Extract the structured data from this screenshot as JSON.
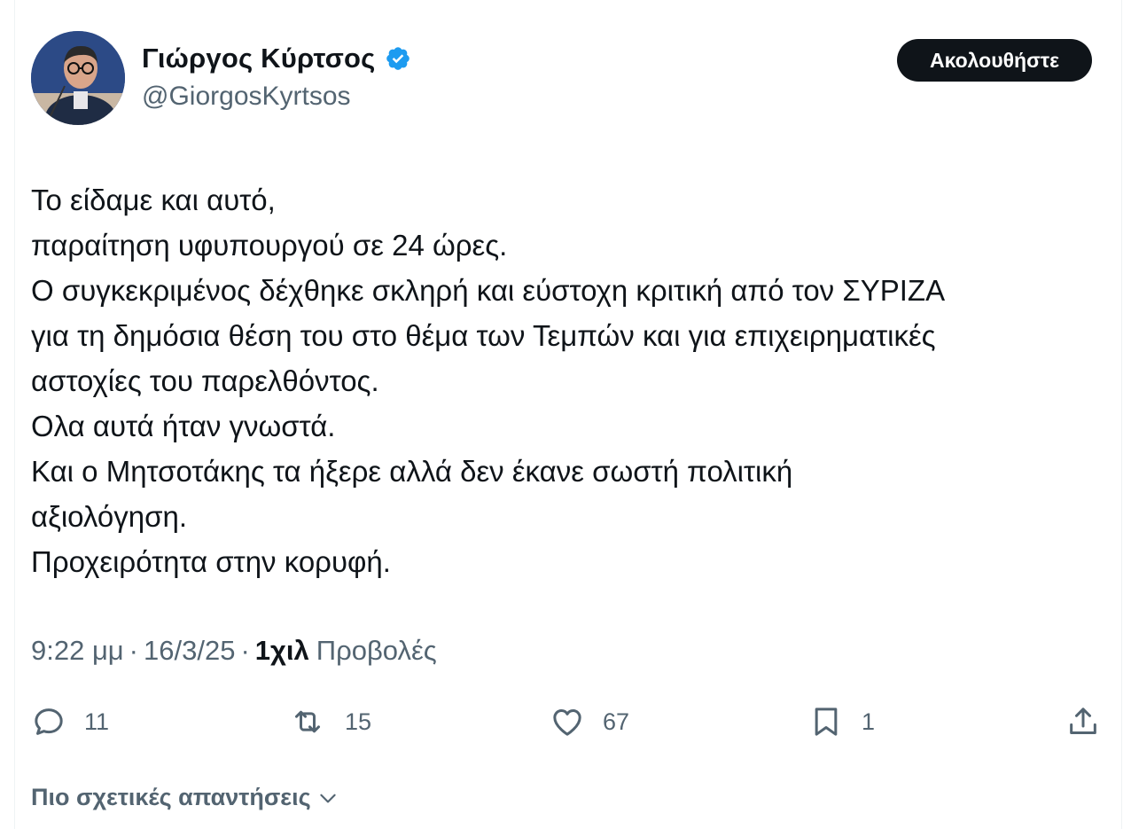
{
  "author": {
    "display_name": "Γιώργος Κύρτσος",
    "handle": "@GiorgosKyrtsos",
    "verified": true,
    "avatar_icon": "profile-photo"
  },
  "follow_button": {
    "label": "Ακολουθήστε"
  },
  "tweet": {
    "lines": [
      "Το είδαμε και αυτό,",
      "παραίτηση υφυπουργού σε 24 ώρες.",
      "Ο συγκεκριμένος δέχθηκε σκληρή και εύστοχη κριτική από τον ΣΥΡΙΖΑ",
      "για τη δημόσια θέση του στο θέμα των Τεμπών και για επιχειρηματικές",
      "αστοχίες του παρελθόντος.",
      "Ολα αυτά ήταν γνωστά.",
      "Και ο Μητσοτάκης τα ήξερε αλλά δεν έκανε σωστή πολιτική",
      "αξιολόγηση.",
      "Προχειρότητα στην κορυφή."
    ]
  },
  "meta": {
    "time": "9:22 μμ",
    "separator": "·",
    "date": "16/3/25",
    "views_count": "1χιλ",
    "views_label": "Προβολές"
  },
  "actions": {
    "replies": {
      "icon": "reply-icon",
      "count": "11"
    },
    "reposts": {
      "icon": "repost-icon",
      "count": "15"
    },
    "likes": {
      "icon": "heart-icon",
      "count": "67"
    },
    "bookmarks": {
      "icon": "bookmark-icon",
      "count": "1"
    },
    "share": {
      "icon": "share-icon"
    }
  },
  "more_replies": {
    "label": "Πιο σχετικές απαντήσεις",
    "icon": "chevron-down-icon"
  },
  "colors": {
    "text_primary": "#0f1419",
    "text_secondary": "#536471",
    "verified_blue": "#1d9bf0",
    "button_bg": "#0f1419"
  }
}
